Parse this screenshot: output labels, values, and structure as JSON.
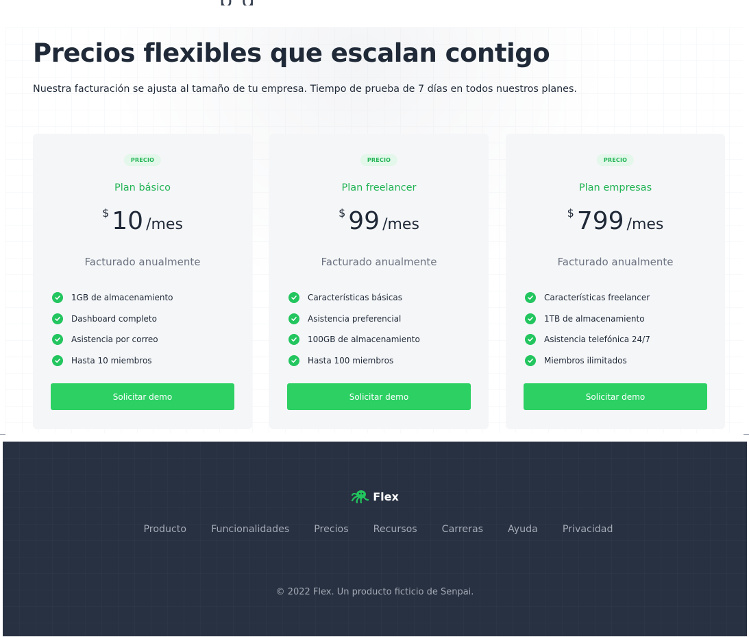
{
  "top_fragment": "p    g",
  "pricing": {
    "title": "Precios flexibles que escalan contigo",
    "subtitle": "Nuestra facturación se ajusta al tamaño de tu empresa. Tiempo de prueba de 7 días en todos nuestros planes.",
    "plans": [
      {
        "badge": "PRECIO",
        "name": "Plan básico",
        "currency": "$",
        "amount": "10",
        "period": "/mes",
        "billing": "Facturado anualmente",
        "features": [
          "1GB de almacenamiento",
          "Dashboard completo",
          "Asistencia por correo",
          "Hasta 10 miembros"
        ],
        "cta": "Solicitar demo"
      },
      {
        "badge": "PRECIO",
        "name": "Plan freelancer",
        "currency": "$",
        "amount": "99",
        "period": "/mes",
        "billing": "Facturado anualmente",
        "features": [
          "Características básicas",
          "Asistencia preferencial",
          "100GB de almacenamiento",
          "Hasta 100 miembros"
        ],
        "cta": "Solicitar demo"
      },
      {
        "badge": "PRECIO",
        "name": "Plan empresas",
        "currency": "$",
        "amount": "799",
        "period": "/mes",
        "billing": "Facturado anualmente",
        "features": [
          "Características freelancer",
          "1TB de almacenamiento",
          "Asistencia telefónica 24/7",
          "Miembros ilimitados"
        ],
        "cta": "Solicitar demo"
      }
    ]
  },
  "footer": {
    "brand": "Flex",
    "logo_icon": "octopus-icon",
    "nav": [
      "Producto",
      "Funcionalidades",
      "Precios",
      "Recursos",
      "Carreras",
      "Ayuda",
      "Privacidad"
    ],
    "copyright": "© 2022 Flex. Un producto ficticio de Senpai."
  },
  "colors": {
    "accent_green": "#22c55e",
    "button_green": "#2cd063",
    "footer_bg": "#283141",
    "card_bg": "#f5f6f8"
  }
}
